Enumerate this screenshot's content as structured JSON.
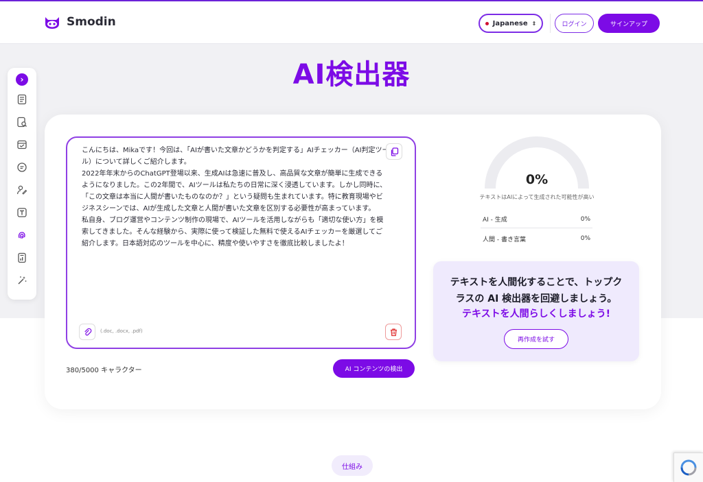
{
  "header": {
    "brand": "Smodin",
    "language": "Japanese",
    "login_label": "ログイン",
    "signup_label": "サインアップ"
  },
  "page": {
    "title": "AI検出器"
  },
  "sidebar": {
    "items": [
      {
        "icon": "document-icon"
      },
      {
        "icon": "search-document-icon"
      },
      {
        "icon": "checklist-icon"
      },
      {
        "icon": "citation-icon"
      },
      {
        "icon": "writer-icon"
      },
      {
        "icon": "text-icon"
      },
      {
        "icon": "fingerprint-icon"
      },
      {
        "icon": "report-icon"
      },
      {
        "icon": "magic-wand-icon"
      }
    ]
  },
  "editor": {
    "text": "こんにちは、Mikaです！今回は、「AIが書いた文章かどうかを判定する」AIチェッカー（AI判定ツール）について詳しくご紹介します。\n2022年年末からのChatGPT登場以来、生成AIは急速に普及し、高品質な文章が簡単に生成できるようになりました。この2年間で、AIツールは私たちの日常に深く浸透しています。しかし同時に、「この文章は本当に人間が書いたものなのか？」という疑問も生まれています。特に教育現場やビジネスシーンでは、AIが生成した文章と人間が書いた文章を区別する必要性が高まっています。\n私自身、ブログ運営やコンテンツ制作の現場で、AIツールを活用しながらも「適切な使い方」を模索してきました。そんな経験から、実際に使って検証した無料で使えるAIチェッカーを厳選してご紹介します。日本語対応のツールを中心に、精度や使いやすさを徹底比較しましたよ！",
    "formats": "(.doc, .docx, .pdf)",
    "char_count": "380/5000 キャラクター",
    "detect_label": "AI コンテンツの検出"
  },
  "result": {
    "percent_text": "0%",
    "ai_fraction": 0,
    "caption": "テキストはAIによって生成された可能性が高い",
    "rows": [
      {
        "label": "AI - 生成",
        "value": "0%"
      },
      {
        "label": "人間 - 書き言葉",
        "value": "0%"
      }
    ]
  },
  "promo": {
    "line1": "テキストを人間化することで、トップク",
    "line2": "ラスの AI 検出器を回避しましょう。",
    "line3": "テキストを人間らしくしましょう!",
    "button_label": "再作成を試す"
  },
  "footer": {
    "how_label": "仕組み"
  },
  "colors": {
    "accent": "#7c0be6",
    "gauge_track": "#ececf0"
  }
}
